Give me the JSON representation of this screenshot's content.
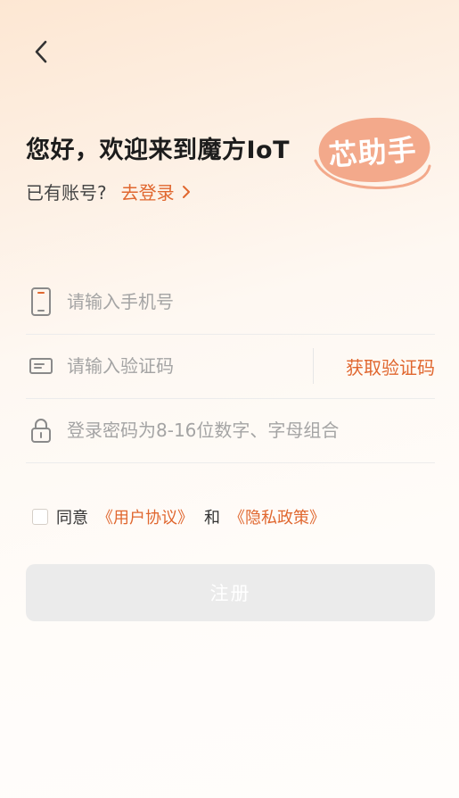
{
  "header": {
    "back_icon": "chevron-left-icon",
    "title": "您好，欢迎来到魔方IoT",
    "badge_text": "芯助手",
    "badge_color": "#f3a98b"
  },
  "login": {
    "prompt": "已有账号?",
    "link_label": "去登录",
    "link_icon": "chevron-right-icon"
  },
  "form": {
    "phone": {
      "icon": "phone-icon",
      "placeholder": "请输入手机号",
      "value": ""
    },
    "code": {
      "icon": "message-card-icon",
      "placeholder": "请输入验证码",
      "value": "",
      "get_code_label": "获取验证码"
    },
    "password": {
      "icon": "lock-icon",
      "placeholder": "登录密码为8-16位数字、字母组合",
      "value": ""
    }
  },
  "agreement": {
    "checked": false,
    "prefix": "同意",
    "user_agreement": "《用户协议》",
    "and": "和",
    "privacy_policy": "《隐私政策》"
  },
  "register_button": {
    "label": "注册",
    "disabled": true
  },
  "colors": {
    "accent": "#e0672f",
    "button_disabled_bg": "#ebebeb",
    "background_top": "#fde7d3"
  }
}
